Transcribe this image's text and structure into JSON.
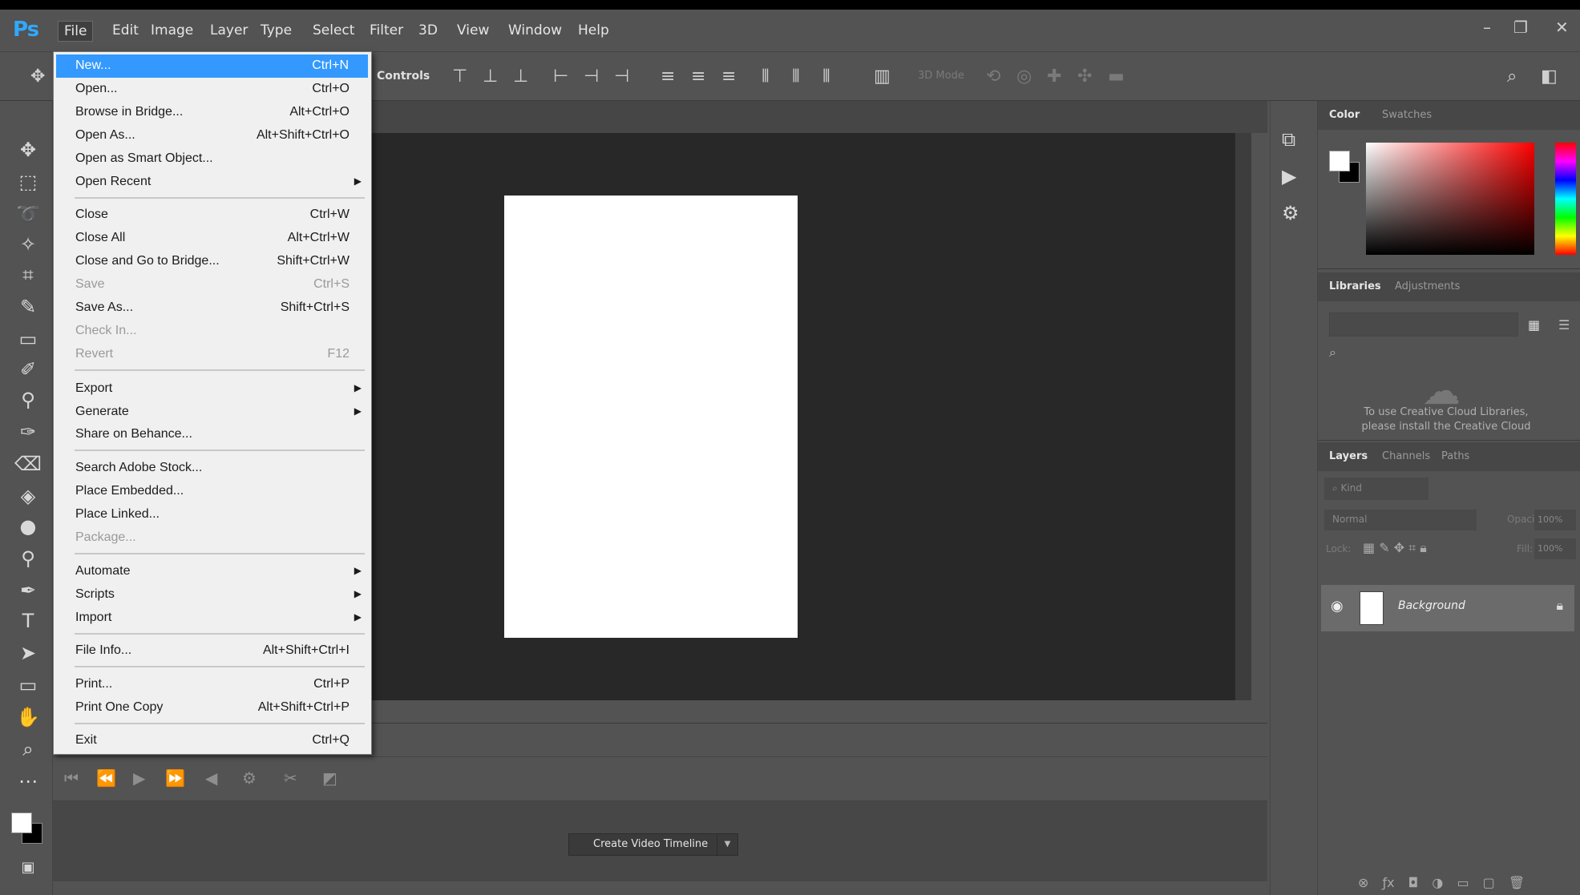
{
  "app": {
    "logo": "Ps"
  },
  "menubar": {
    "items": [
      "File",
      "Edit",
      "Image",
      "Layer",
      "Type",
      "Select",
      "Filter",
      "3D",
      "View",
      "Window",
      "Help"
    ],
    "active": "File"
  },
  "options_bar": {
    "controls_label": "Controls",
    "mode_label": "3D Mode"
  },
  "file_menu": {
    "groups": [
      [
        {
          "label": "New...",
          "shortcut": "Ctrl+N",
          "highlighted": true
        },
        {
          "label": "Open...",
          "shortcut": "Ctrl+O"
        },
        {
          "label": "Browse in Bridge...",
          "shortcut": "Alt+Ctrl+O"
        },
        {
          "label": "Open As...",
          "shortcut": "Alt+Shift+Ctrl+O"
        },
        {
          "label": "Open as Smart Object...",
          "shortcut": ""
        },
        {
          "label": "Open Recent",
          "shortcut": "",
          "submenu": true
        }
      ],
      [
        {
          "label": "Close",
          "shortcut": "Ctrl+W"
        },
        {
          "label": "Close All",
          "shortcut": "Alt+Ctrl+W"
        },
        {
          "label": "Close and Go to Bridge...",
          "shortcut": "Shift+Ctrl+W"
        },
        {
          "label": "Save",
          "shortcut": "Ctrl+S",
          "disabled": true
        },
        {
          "label": "Save As...",
          "shortcut": "Shift+Ctrl+S"
        },
        {
          "label": "Check In...",
          "shortcut": "",
          "disabled": true
        },
        {
          "label": "Revert",
          "shortcut": "F12",
          "disabled": true
        }
      ],
      [
        {
          "label": "Export",
          "shortcut": "",
          "submenu": true
        },
        {
          "label": "Generate",
          "shortcut": "",
          "submenu": true
        },
        {
          "label": "Share on Behance...",
          "shortcut": ""
        }
      ],
      [
        {
          "label": "Search Adobe Stock...",
          "shortcut": ""
        },
        {
          "label": "Place Embedded...",
          "shortcut": ""
        },
        {
          "label": "Place Linked...",
          "shortcut": ""
        },
        {
          "label": "Package...",
          "shortcut": "",
          "disabled": true
        }
      ],
      [
        {
          "label": "Automate",
          "shortcut": "",
          "submenu": true
        },
        {
          "label": "Scripts",
          "shortcut": "",
          "submenu": true
        },
        {
          "label": "Import",
          "shortcut": "",
          "submenu": true
        }
      ],
      [
        {
          "label": "File Info...",
          "shortcut": "Alt+Shift+Ctrl+I"
        }
      ],
      [
        {
          "label": "Print...",
          "shortcut": "Ctrl+P"
        },
        {
          "label": "Print One Copy",
          "shortcut": "Alt+Shift+Ctrl+P"
        }
      ],
      [
        {
          "label": "Exit",
          "shortcut": "Ctrl+Q"
        }
      ]
    ]
  },
  "timeline": {
    "create_button": "Create Video Timeline"
  },
  "color_panel": {
    "tabs": [
      "Color",
      "Swatches"
    ],
    "active": "Color"
  },
  "libraries_panel": {
    "tabs": [
      "Libraries",
      "Adjustments"
    ],
    "active": "Libraries",
    "message": "To use Creative Cloud Libraries, please install the Creative Cloud"
  },
  "layers_panel": {
    "tabs": [
      "Layers",
      "Channels",
      "Paths"
    ],
    "active": "Layers",
    "filter_placeholder": "Kind",
    "blend_mode": "Normal",
    "opacity_label": "Opacity:",
    "opacity_value": "100%",
    "lock_label": "Lock:",
    "fill_label": "Fill:",
    "fill_value": "100%",
    "layers": [
      {
        "name": "Background",
        "visible": true,
        "locked": true
      }
    ]
  },
  "colors": {
    "menu_highlight": "#3399ff",
    "ui_bg": "#535353",
    "canvas_bg": "#282828"
  }
}
